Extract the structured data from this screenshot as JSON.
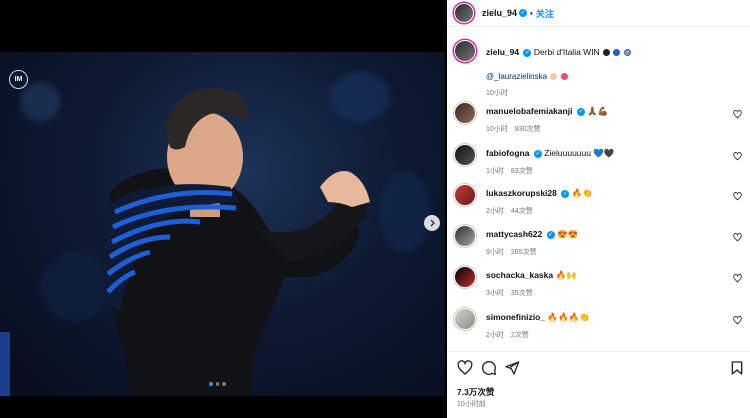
{
  "post": {
    "author": "zielu_94",
    "follow_label": "关注",
    "caption": "Derbi d'Italia WIN",
    "mention": "@_laurazielinska",
    "caption_time": "10小时",
    "likes": "7.3万次赞",
    "posted": "10小时前"
  },
  "media": {
    "logo_text": "IM",
    "carousel_dots": 3,
    "active_dot": 1
  },
  "comments": [
    {
      "user": "manuelobafemiakanji",
      "text": "🙏🏾💪🏾",
      "time": "10小时",
      "likes": "930次赞"
    },
    {
      "user": "fabiofogna",
      "text": "Zieluuuuuuu 💙🖤",
      "time": "1小时",
      "likes": "83次赞"
    },
    {
      "user": "lukaszkorupski28",
      "text": "🔥👏",
      "time": "2小时",
      "likes": "44次赞"
    },
    {
      "user": "mattycash622",
      "text": "😍😍",
      "time": "9小时",
      "likes": "265次赞"
    },
    {
      "user": "sochacka_kaska",
      "text": "🔥🙌",
      "time": "3小时",
      "likes": "35次赞"
    },
    {
      "user": "simonefinizio_",
      "text": "🔥🔥🔥👏",
      "time": "2小时",
      "likes": "2次赞"
    }
  ],
  "colors": {
    "accent": "#0095f6",
    "meta_text": "#737373",
    "jersey_blue": "#1e5fd6"
  }
}
